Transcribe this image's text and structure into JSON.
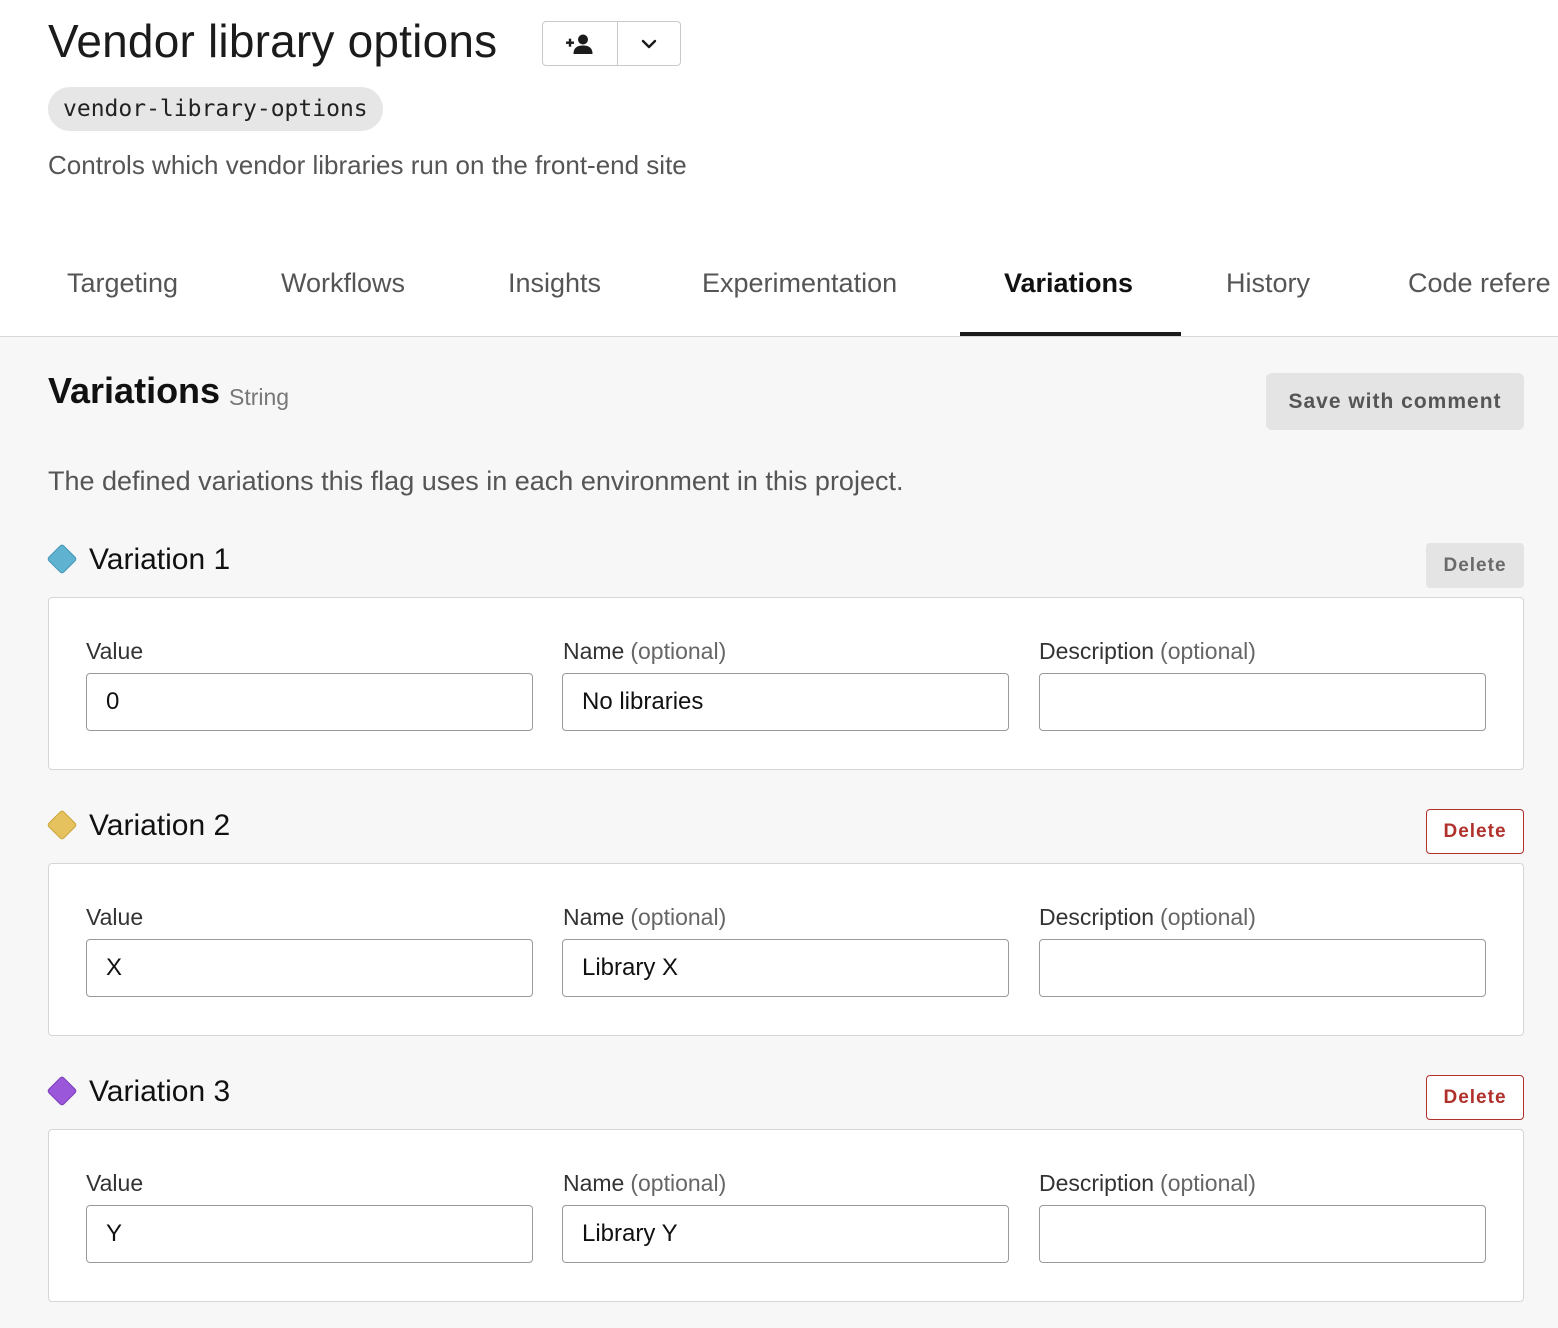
{
  "header": {
    "title": "Vendor library options",
    "flag_key": "vendor-library-options",
    "description": "Controls which vendor libraries run on the front-end site"
  },
  "tabs": [
    {
      "label": "Targeting"
    },
    {
      "label": "Workflows"
    },
    {
      "label": "Insights"
    },
    {
      "label": "Experimentation"
    },
    {
      "label": "Variations",
      "active": true
    },
    {
      "label": "History"
    },
    {
      "label": "Code refere"
    }
  ],
  "section": {
    "title": "Variations",
    "type": "String",
    "save_label": "Save with comment",
    "description": "The defined variations this flag uses in each environment in this project."
  },
  "field_labels": {
    "value": "Value",
    "name": "Name",
    "description": "Description",
    "optional": "(optional)"
  },
  "variations": [
    {
      "title": "Variation 1",
      "color": "#5fb3d1",
      "delete_label": "Delete",
      "delete_enabled": false,
      "value": "0",
      "name": "No libraries",
      "description": ""
    },
    {
      "title": "Variation 2",
      "color": "#e6c25e",
      "delete_label": "Delete",
      "delete_enabled": true,
      "value": "X",
      "name": "Library X",
      "description": ""
    },
    {
      "title": "Variation 3",
      "color": "#9a57d9",
      "delete_label": "Delete",
      "delete_enabled": true,
      "value": "Y",
      "name": "Library Y",
      "description": ""
    }
  ],
  "icons": {
    "add_member": "add-person-icon",
    "dropdown": "chevron-down-icon",
    "variation_marker": "diamond-icon"
  },
  "colors": {
    "danger": "#b0312c",
    "accent_underline": "#1b1b1b"
  }
}
